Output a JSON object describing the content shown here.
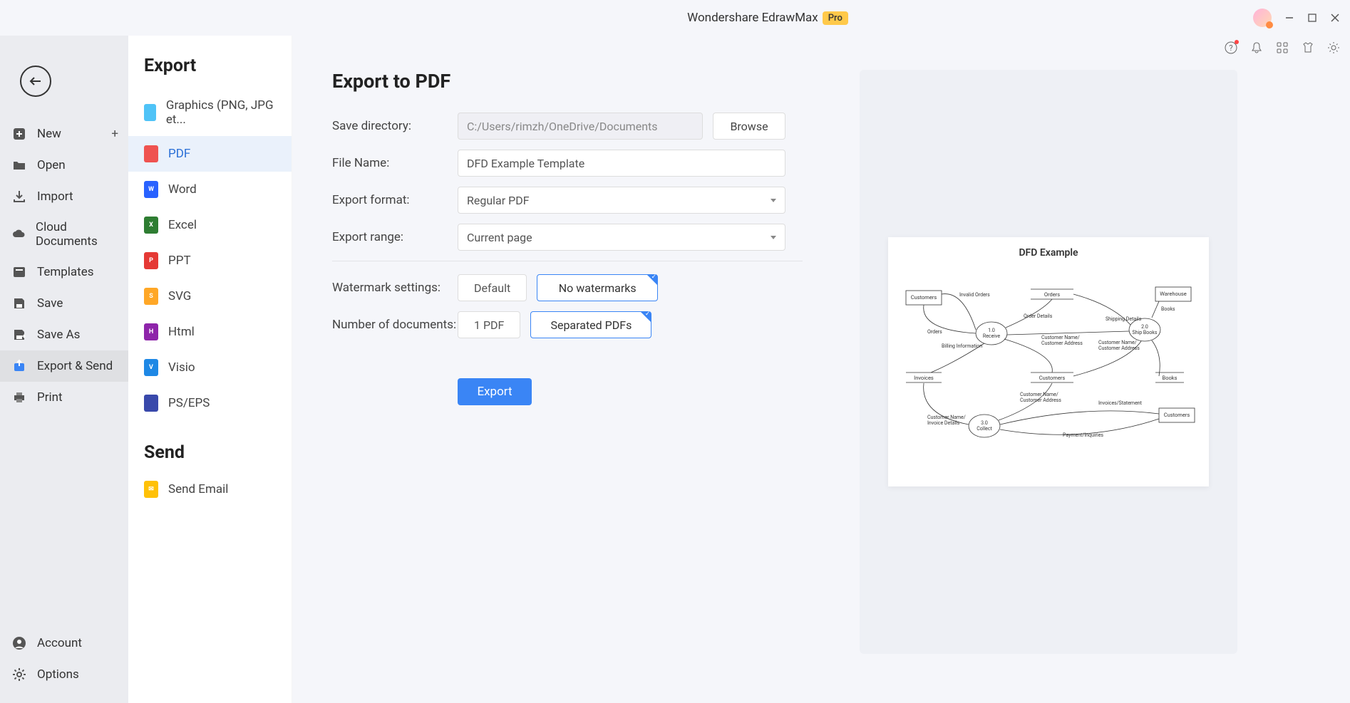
{
  "app_title": "Wondershare EdrawMax",
  "app_badge": "Pro",
  "left_nav": {
    "new": "New",
    "open": "Open",
    "import": "Import",
    "cloud": "Cloud Documents",
    "templates": "Templates",
    "save": "Save",
    "saveas": "Save As",
    "export": "Export & Send",
    "print": "Print",
    "account": "Account",
    "options": "Options"
  },
  "export_panel": {
    "title": "Export",
    "send_title": "Send",
    "formats": {
      "graphics": "Graphics (PNG, JPG et...",
      "pdf": "PDF",
      "word": "Word",
      "excel": "Excel",
      "ppt": "PPT",
      "svg": "SVG",
      "html": "Html",
      "visio": "Visio",
      "ps": "PS/EPS"
    },
    "send_email": "Send Email"
  },
  "form": {
    "heading": "Export to PDF",
    "labels": {
      "save_dir": "Save directory:",
      "file_name": "File Name:",
      "export_format": "Export format:",
      "export_range": "Export range:",
      "watermark": "Watermark settings:",
      "num_docs": "Number of documents:"
    },
    "save_dir_value": "C:/Users/rimzh/OneDrive/Documents",
    "file_name_value": "DFD Example Template",
    "export_format_value": "Regular PDF",
    "export_range_value": "Current page",
    "watermark_default": "Default",
    "watermark_none": "No watermarks",
    "docs_one": "1 PDF",
    "docs_sep": "Separated PDFs",
    "browse": "Browse",
    "export_button": "Export"
  },
  "preview": {
    "title": "DFD Example"
  }
}
